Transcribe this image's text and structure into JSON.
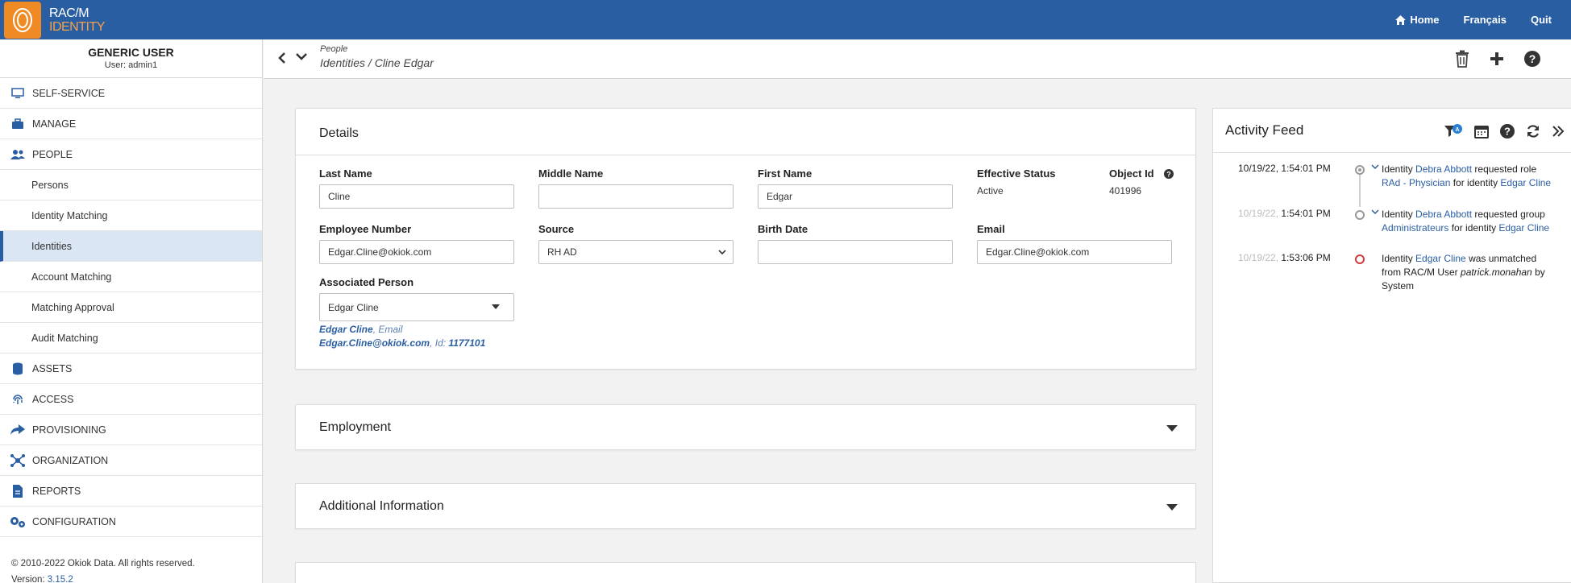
{
  "brand": {
    "line1": "RAC/M",
    "line2": "IDENTITY"
  },
  "topnav": {
    "home": "Home",
    "lang": "Français",
    "quit": "Quit"
  },
  "user": {
    "name": "GENERIC USER",
    "login": "User: admin1"
  },
  "sidebar": {
    "items": [
      {
        "label": "SELF-SERVICE",
        "icon": "monitor-icon"
      },
      {
        "label": "MANAGE",
        "icon": "toolbox-icon"
      },
      {
        "label": "PEOPLE",
        "icon": "people-icon"
      },
      {
        "label": "Persons"
      },
      {
        "label": "Identity Matching"
      },
      {
        "label": "Identities"
      },
      {
        "label": "Account Matching"
      },
      {
        "label": "Matching Approval"
      },
      {
        "label": "Audit Matching"
      },
      {
        "label": "ASSETS",
        "icon": "database-icon"
      },
      {
        "label": "ACCESS",
        "icon": "fingerprint-icon"
      },
      {
        "label": "PROVISIONING",
        "icon": "share-icon"
      },
      {
        "label": "ORGANIZATION",
        "icon": "network-icon"
      },
      {
        "label": "REPORTS",
        "icon": "report-icon"
      },
      {
        "label": "CONFIGURATION",
        "icon": "gears-icon"
      }
    ],
    "copyright": "© 2010-2022 Okiok Data. All rights reserved.",
    "version_label": "Version: ",
    "version": "3.15.2"
  },
  "header": {
    "section": "People",
    "crumb": "Identities / Cline Edgar"
  },
  "details": {
    "title": "Details",
    "last_name_label": "Last Name",
    "last_name": "Cline",
    "middle_name_label": "Middle Name",
    "middle_name": "",
    "first_name_label": "First Name",
    "first_name": "Edgar",
    "status_label": "Effective Status",
    "status": "Active",
    "object_id_label": "Object Id",
    "object_id": "401996",
    "employee_number_label": "Employee Number",
    "employee_number": "Edgar.Cline@okiok.com",
    "source_label": "Source",
    "source": "RH AD",
    "birth_date_label": "Birth Date",
    "birth_date": "",
    "email_label": "Email",
    "email": "Edgar.Cline@okiok.com",
    "assoc_label": "Associated Person",
    "assoc": "Edgar Cline",
    "assoc_name": "Edgar Cline",
    "assoc_email_label": ", Email",
    "assoc_email": "Edgar.Cline@okiok.com",
    "assoc_id_label": ", Id: ",
    "assoc_id": "1177101"
  },
  "sections": {
    "employment": "Employment",
    "additional": "Additional Information"
  },
  "feed": {
    "title": "Activity Feed",
    "entries": [
      {
        "ts": "10/19/22, 1:54:01 PM",
        "ts_dim": "",
        "p1": "Identity ",
        "l1": "Debra Abbott",
        "p2": " requested role ",
        "l2": "RAd - Physician",
        "p3": " for identity ",
        "l3": "Edgar Cline"
      },
      {
        "ts_dim": "10/19/22,",
        "ts": " 1:54:01 PM",
        "p1": "Identity ",
        "l1": "Debra Abbott",
        "p2": " requested group ",
        "l2": "Administrateurs",
        "p3": " for identity ",
        "l3": "Edgar Cline"
      },
      {
        "ts_dim": "10/19/22,",
        "ts": " 1:53:06 PM",
        "p1": "Identity ",
        "l1": "Edgar Cline",
        "p2": " was unmatched from RAC/M User ",
        "i1": "patrick.monahan",
        "p3": " by System"
      }
    ]
  }
}
